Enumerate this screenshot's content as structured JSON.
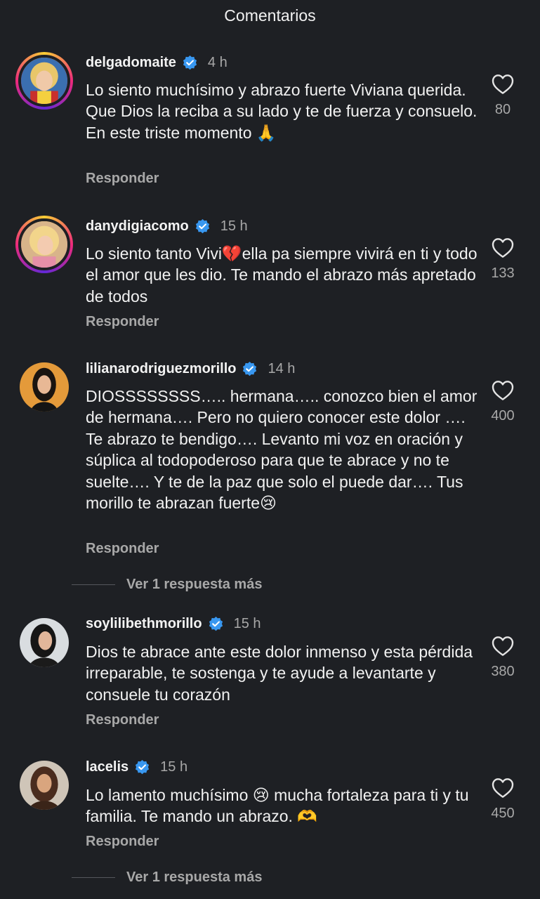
{
  "header": {
    "title": "Comentarios"
  },
  "comments": [
    {
      "username": "delgadomaite",
      "time": "4 h",
      "text": "Lo siento muchísimo y abrazo fuerte Viviana querida. Que Dios la reciba a su lado y te de fuerza y consuelo. En este triste momento 🙏",
      "likes": "80",
      "reply": "Responder",
      "story_ring": true
    },
    {
      "username": "danydigiacomo",
      "time": "15 h",
      "text": "Lo siento tanto Vivi💔ella pa siempre vivirá en ti y todo el amor que les dio. Te mando el abrazo más apretado de todos",
      "likes": "133",
      "reply": "Responder",
      "story_ring": true
    },
    {
      "username": "lilianarodriguezmorillo",
      "time": "14 h",
      "text": "DIOSSSSSSSS….. hermana….. conozco bien el amor de hermana…. Pero no quiero conocer este dolor …. Te abrazo te bendigo…. Levanto mi voz en oración y súplica al todopoderoso para que te abrace y no te suelte…. Y te de la paz que solo el puede dar…. Tus morillo te abrazan fuerte😢",
      "likes": "400",
      "reply": "Responder",
      "more_replies": "Ver 1 respuesta más",
      "story_ring": false
    },
    {
      "username": "soylilibethmorillo",
      "time": "15 h",
      "text": "Dios te abrace ante este dolor inmenso y esta pérdida irreparable, te sostenga y te ayude a levantarte y consuele tu corazón",
      "likes": "380",
      "reply": "Responder",
      "story_ring": false
    },
    {
      "username": "lacelis",
      "time": "15 h",
      "text": "Lo lamento muchísimo 😢 mucha fortaleza para ti y tu familia. Te mando un abrazo. 🫶",
      "likes": "450",
      "reply": "Responder",
      "more_replies": "Ver 1 respuesta más",
      "story_ring": false
    }
  ],
  "icons": {
    "verified": "verified-badge-icon",
    "like": "heart-outline-icon"
  },
  "colors": {
    "background": "#1e2024",
    "verified": "#3897f0",
    "secondary_text": "#a8a8a8"
  }
}
